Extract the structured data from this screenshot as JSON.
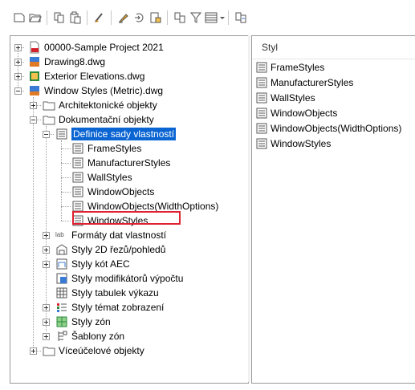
{
  "toolbar": {
    "buttons": [
      {
        "name": "new-drawing-icon"
      },
      {
        "name": "open-folder-icon"
      },
      {
        "name": "copy-icon"
      },
      {
        "name": "paste-icon"
      },
      {
        "name": "purge-icon"
      },
      {
        "name": "edit-style-icon"
      },
      {
        "name": "set-from-icon"
      },
      {
        "name": "import-icon"
      },
      {
        "name": "filter-icon"
      },
      {
        "name": "view-dropdown-icon"
      },
      {
        "name": "synchronize-icon"
      }
    ]
  },
  "tree": {
    "drawings": [
      {
        "label": "00000-Sample Project 2021",
        "icon": "pdf-icon"
      },
      {
        "label": "Drawing8.dwg",
        "icon": "dwg-icon"
      },
      {
        "label": "Exterior Elevations.dwg",
        "icon": "dwg-icon"
      },
      {
        "label": "Window Styles (Metric).dwg",
        "icon": "dwg-icon"
      }
    ],
    "categories": {
      "arch": "Architektonické objekty",
      "doc": "Dokumentační objekty",
      "multi": "Víceúčelové objekty"
    },
    "property_set": "Definice sady vlastností",
    "property_set_children": [
      "FrameStyles",
      "ManufacturerStyles",
      "WallStyles",
      "WindowObjects",
      "WindowObjects(WidthOptions)",
      "WindowStyles"
    ],
    "doc_children": [
      {
        "label": "Formáty dat vlastností",
        "expandable": true
      },
      {
        "label": "Styly 2D řezů/pohledů",
        "expandable": true
      },
      {
        "label": "Styly kót AEC",
        "expandable": true
      },
      {
        "label": "Styly modifikátorů výpočtu",
        "expandable": false
      },
      {
        "label": "Styly tabulek výkazu",
        "expandable": false
      },
      {
        "label": "Styly témat zobrazení",
        "expandable": true
      },
      {
        "label": "Styly zón",
        "expandable": true
      },
      {
        "label": "Šablony zón",
        "expandable": true
      }
    ],
    "doc_child_abbr": "lab"
  },
  "list": {
    "header": "Styl",
    "items": [
      "FrameStyles",
      "ManufacturerStyles",
      "WallStyles",
      "WindowObjects",
      "WindowObjects(WidthOptions)",
      "WindowStyles"
    ]
  },
  "colors": {
    "selection": "#0a64d2",
    "highlight_box": "#e0212f"
  }
}
